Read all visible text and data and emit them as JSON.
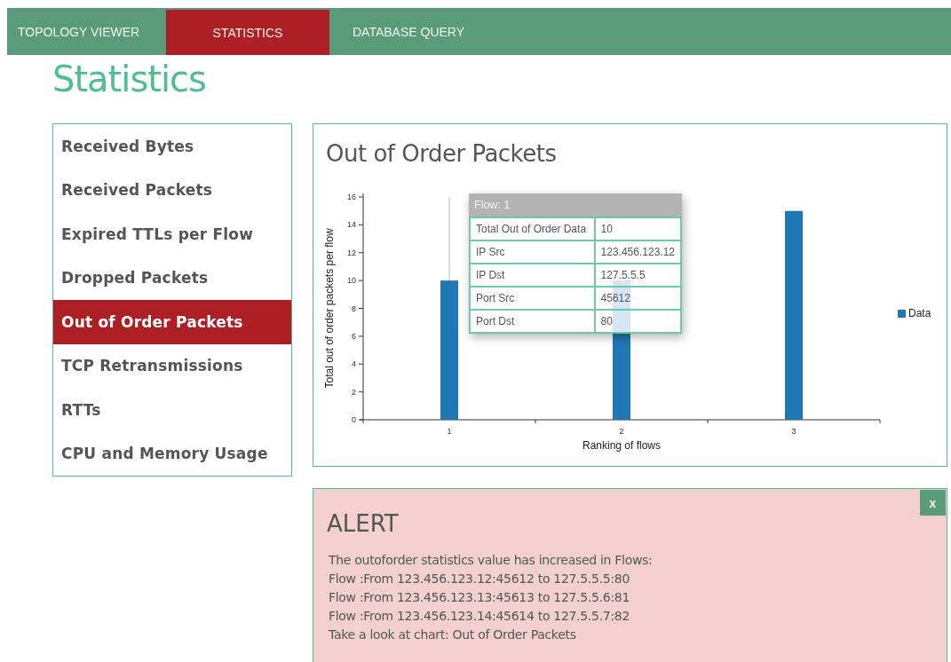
{
  "tabs": [
    {
      "label": "TOPOLOGY VIEWER",
      "selected": false
    },
    {
      "label": "STATISTICS",
      "selected": true
    },
    {
      "label": "DATABASE QUERY",
      "selected": false
    }
  ],
  "page_title": "Statistics",
  "sidebar": {
    "items": [
      {
        "label": "Received Bytes",
        "selected": false
      },
      {
        "label": "Received Packets",
        "selected": false
      },
      {
        "label": "Expired TTLs per Flow",
        "selected": false
      },
      {
        "label": "Dropped Packets",
        "selected": false
      },
      {
        "label": "Out of Order Packets",
        "selected": true
      },
      {
        "label": "TCP Retransmissions",
        "selected": false
      },
      {
        "label": "RTTs",
        "selected": false
      },
      {
        "label": "CPU and Memory Usage",
        "selected": false
      }
    ]
  },
  "chart_panel": {
    "title": "Out of Order Packets",
    "chart_data": {
      "type": "bar",
      "xlabel": "Ranking of flows",
      "ylabel": "Total out of order packets per flow",
      "categories": [
        "1",
        "2",
        "3"
      ],
      "series": [
        {
          "name": "Data",
          "color": "#1f77b4",
          "values": [
            10,
            10,
            15
          ]
        }
      ],
      "ylim": [
        0,
        16
      ],
      "yticks": [
        0,
        2,
        4,
        6,
        8,
        10,
        12,
        14,
        16
      ]
    },
    "tooltip": {
      "title": "Flow: 1",
      "rows": [
        {
          "label": "Total Out of Order Data",
          "value": "10"
        },
        {
          "label": "IP Src",
          "value": "123.456.123.12"
        },
        {
          "label": "IP Dst",
          "value": "127.5.5.5"
        },
        {
          "label": "Port Src",
          "value": "45612"
        },
        {
          "label": "Port Dst",
          "value": "80"
        }
      ]
    }
  },
  "alert": {
    "close": "x",
    "title": "ALERT",
    "lines": [
      "The outoforder statistics value has increased in Flows:",
      "Flow :From 123.456.123.12:45612 to 127.5.5.5:80",
      "Flow :From 123.456.123.13:45613 to 127.5.5.6:81",
      "Flow :From 123.456.123.14:45614 to 127.5.5.7:82",
      "Take a look at chart: Out of Order Packets"
    ]
  }
}
